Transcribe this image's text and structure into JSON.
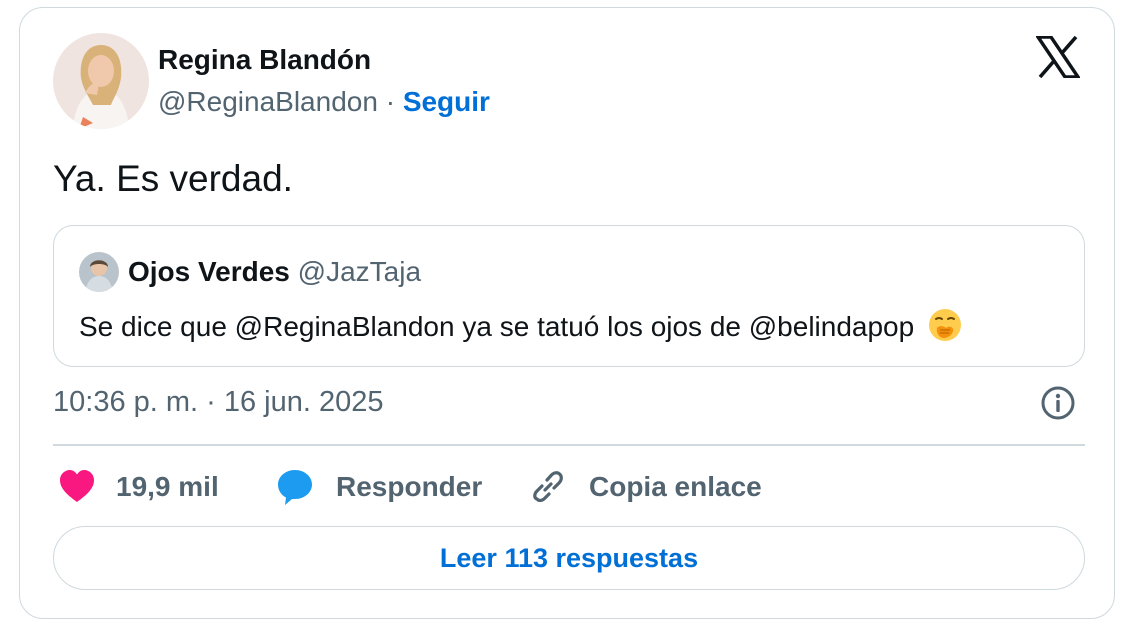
{
  "author": {
    "name": "Regina Blandón",
    "handle": "@ReginaBlandon",
    "separator": "·",
    "follow_label": "Seguir"
  },
  "logo_icon": "x-logo-icon",
  "tweet": {
    "text": "Ya. Es verdad."
  },
  "quoted": {
    "name": "Ojos Verdes",
    "handle": "@JazTaja",
    "text": "Se dice que @ReginaBlandon ya se tatuó los ojos de @belindapop",
    "emoji": "face-with-hand-over-mouth"
  },
  "meta": {
    "timestamp": "10:36 p. m. · 16 jun. 2025",
    "info_icon": "info-icon"
  },
  "actions": {
    "likes": "19,9 mil",
    "reply_label": "Responder",
    "copy_label": "Copia enlace"
  },
  "replies_button": {
    "label": "Leer 113 respuestas"
  },
  "colors": {
    "accent": "#006fd6",
    "like": "#f91880",
    "reply": "#1d9bf0",
    "muted": "#536471",
    "border": "#cfd9de"
  }
}
